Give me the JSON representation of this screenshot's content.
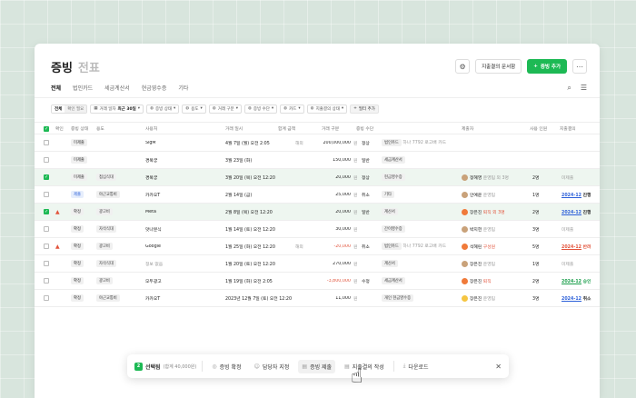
{
  "header": {
    "title": "증빙",
    "title_sub": "전표",
    "settings_icon": "gear-icon",
    "request_button": "지출결의 문서함",
    "add_button": "증빙 추가",
    "more_icon": "more-icon"
  },
  "tabs": [
    {
      "label": "전체",
      "active": true
    },
    {
      "label": "법인카드"
    },
    {
      "label": "세금계산서"
    },
    {
      "label": "현금영수증"
    },
    {
      "label": "기타"
    }
  ],
  "tab_icons": [
    "search-icon",
    "column-settings-icon"
  ],
  "filters": {
    "seg_all": "전체",
    "seg_check": "확인 필요",
    "date_label": "거래 일자",
    "date_value": "최근 30일",
    "chips": [
      "증빙 상태",
      "용도",
      "거래 구분",
      "증빙 수단",
      "카드",
      "지출결의 상태"
    ],
    "add_filter": "필터 추가"
  },
  "columns": [
    "확인",
    "증빙 상태",
    "용도",
    "사용처",
    "거래 일시",
    "합계 금액",
    "거래 구분",
    "증빙 수단",
    "제출자",
    "사용 인원",
    "지출결의"
  ],
  "rows": [
    {
      "checked": false,
      "warn": false,
      "status": "미제출",
      "purpose": "",
      "merchant": "SigM",
      "date": "4월 7일 (월) 오전 2:05",
      "prefix": "해외",
      "amount": "200,000,000",
      "unit": "원",
      "type": "정상",
      "method": "법인카드",
      "method_detail": "하나 7792 로고배 카드",
      "submitter": "",
      "people": "",
      "report": ""
    },
    {
      "checked": false,
      "warn": false,
      "status": "미제출",
      "purpose": "",
      "merchant": "경복궁",
      "date": "3월 23일 (화)",
      "prefix": "",
      "amount": "150,000",
      "unit": "원",
      "type": "일반",
      "method": "세금계산서",
      "method_detail": "",
      "submitter": "",
      "people": "",
      "report": ""
    },
    {
      "checked": true,
      "warn": false,
      "status": "미제출",
      "purpose": "접심식대",
      "merchant": "경복궁",
      "date": "3월 20일 (목) 오전 12:20",
      "prefix": "",
      "amount": "20,000",
      "unit": "원",
      "type": "정상",
      "method": "현금영수증",
      "method_detail": "",
      "submitter": "정혜영",
      "submitter_extra": "운영팀 외 3명",
      "people": "2명",
      "report": "미제출",
      "report_style": "muted"
    },
    {
      "checked": false,
      "warn": false,
      "status": "제출",
      "status_style": "blue",
      "purpose": "야근교통비",
      "merchant": "카카오T",
      "date": "2월 14일 (금)",
      "prefix": "",
      "amount": "25,000",
      "unit": "원",
      "type": "취소",
      "method": "기타",
      "method_detail": "",
      "submitter": "안예윤",
      "submitter_extra": "운영팀",
      "people": "1명",
      "report": "2024-12",
      "report_style": "dblue",
      "report_extra": "진행"
    },
    {
      "checked": true,
      "warn": true,
      "status": "확정",
      "purpose": "광고비",
      "merchant": "Meta",
      "date": "2월 8일 (목) 오전 12:20",
      "prefix": "",
      "amount": "20,000",
      "unit": "원",
      "type": "일반",
      "method": "계산서",
      "method_detail": "",
      "submitter": "장은진",
      "submitter_extra": "퇴직 외 3명",
      "submitter_style": "red",
      "people": "2명",
      "report": "2024-12",
      "report_style": "dblue",
      "report_extra": "진행"
    },
    {
      "checked": false,
      "warn": false,
      "status": "확정",
      "purpose": "자삭식대",
      "merchant": "맛나분식",
      "date": "1월 14일 (토) 오전 12:20",
      "prefix": "",
      "amount": "30,000",
      "unit": "원",
      "type": "",
      "method": "간이영수증",
      "method_detail": "",
      "submitter": "박지헌",
      "submitter_extra": "운영팀",
      "people": "3명",
      "report": "미제출",
      "report_style": "muted"
    },
    {
      "checked": false,
      "warn": true,
      "status": "확정",
      "purpose": "광고비",
      "merchant": "Google",
      "date": "1월 25일 (화) 오전 12:20",
      "prefix": "해외",
      "amount": "-20,000",
      "amount_style": "red",
      "unit": "원",
      "type": "취소",
      "method": "법인카드",
      "method_detail": "하나 7792 로고배 카드",
      "submitter": "석혜린",
      "submitter_extra": "구성원",
      "submitter_style": "red",
      "people": "5명",
      "report": "2024-12",
      "report_style": "dred",
      "report_extra": "반려"
    },
    {
      "checked": false,
      "warn": false,
      "status": "확정",
      "purpose": "자삭식대",
      "merchant": "정보 없음",
      "merchant_style": "muted",
      "date": "1월 20일 (토) 오전 12:20",
      "prefix": "",
      "amount": "270,000",
      "unit": "원",
      "type": "",
      "method": "계산서",
      "method_detail": "",
      "submitter": "장은진",
      "submitter_extra": "운영팀",
      "people": "1명",
      "report": "미제출",
      "report_style": "muted"
    },
    {
      "checked": false,
      "warn": false,
      "status": "확정",
      "purpose": "광고비",
      "merchant": "모두광고",
      "date": "1월 19일 (화) 오전 2:05",
      "prefix": "",
      "amount": "-3,800,000",
      "amount_style": "red",
      "unit": "원",
      "type": "수정",
      "method": "세금계산서",
      "method_detail": "",
      "submitter": "장은진",
      "submitter_extra": "퇴직",
      "submitter_style": "red",
      "people": "2명",
      "report": "2024-12",
      "report_style": "dgreen",
      "report_extra": "승인"
    },
    {
      "checked": false,
      "warn": false,
      "status": "확정",
      "purpose": "야근교통비",
      "merchant": "카카오T",
      "date": "2023년 12월 7일 (토) 오전 12:20",
      "prefix": "",
      "amount": "11,000",
      "unit": "원",
      "type": "",
      "method": "개인 현금영수증",
      "method_detail": "",
      "submitter": "장은진",
      "submitter_extra": "운영팀",
      "people": "3명",
      "report": "2024-12",
      "report_style": "dblue",
      "report_extra": "취소"
    }
  ],
  "toolbar": {
    "count": "2",
    "selected": "선택됨",
    "sum": "(합계 40,000원)",
    "confirm": "증빙 확정",
    "assign": "담당자 지정",
    "submit": "증빙 제출",
    "write": "지출결의 작성",
    "download": "다운로드"
  },
  "colors": {
    "accent": "#1db954",
    "red": "#e2533b",
    "blue": "#2b5fd9"
  }
}
